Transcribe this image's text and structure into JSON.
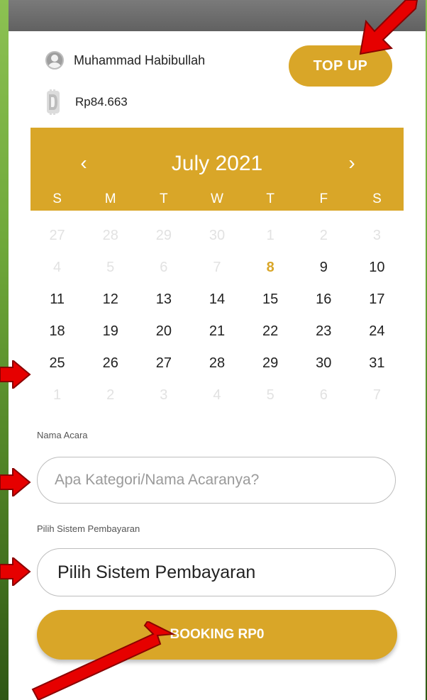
{
  "user": {
    "name": "Muhammad Habibullah",
    "balance": "Rp84.663"
  },
  "topup_label": "TOP UP",
  "calendar": {
    "prev": "‹",
    "month_year": "July  2021",
    "next": "›",
    "weekdays": [
      "S",
      "M",
      "T",
      "W",
      "T",
      "F",
      "S"
    ],
    "days": [
      {
        "d": "27",
        "muted": true
      },
      {
        "d": "28",
        "muted": true
      },
      {
        "d": "29",
        "muted": true
      },
      {
        "d": "30",
        "muted": true
      },
      {
        "d": "1",
        "muted": true
      },
      {
        "d": "2",
        "muted": true
      },
      {
        "d": "3",
        "muted": true
      },
      {
        "d": "4",
        "muted": true
      },
      {
        "d": "5",
        "muted": true
      },
      {
        "d": "6",
        "muted": true
      },
      {
        "d": "7",
        "muted": true
      },
      {
        "d": "8",
        "today": true
      },
      {
        "d": "9"
      },
      {
        "d": "10"
      },
      {
        "d": "11"
      },
      {
        "d": "12"
      },
      {
        "d": "13"
      },
      {
        "d": "14"
      },
      {
        "d": "15"
      },
      {
        "d": "16"
      },
      {
        "d": "17"
      },
      {
        "d": "18"
      },
      {
        "d": "19"
      },
      {
        "d": "20"
      },
      {
        "d": "21"
      },
      {
        "d": "22"
      },
      {
        "d": "23"
      },
      {
        "d": "24"
      },
      {
        "d": "25"
      },
      {
        "d": "26"
      },
      {
        "d": "27"
      },
      {
        "d": "28"
      },
      {
        "d": "29"
      },
      {
        "d": "30"
      },
      {
        "d": "31"
      },
      {
        "d": "1",
        "muted": true
      },
      {
        "d": "2",
        "muted": true
      },
      {
        "d": "3",
        "muted": true
      },
      {
        "d": "4",
        "muted": true
      },
      {
        "d": "5",
        "muted": true
      },
      {
        "d": "6",
        "muted": true
      },
      {
        "d": "7",
        "muted": true
      }
    ]
  },
  "form": {
    "event_label": "Nama Acara",
    "event_placeholder": "Apa Kategori/Nama Acaranya?",
    "payment_label": "Pilih Sistem Pembayaran",
    "payment_value": "Pilih Sistem Pembayaran"
  },
  "booking_label": "BOOKING RP0",
  "colors": {
    "accent": "#d9a628",
    "arrow": "#e60000"
  }
}
